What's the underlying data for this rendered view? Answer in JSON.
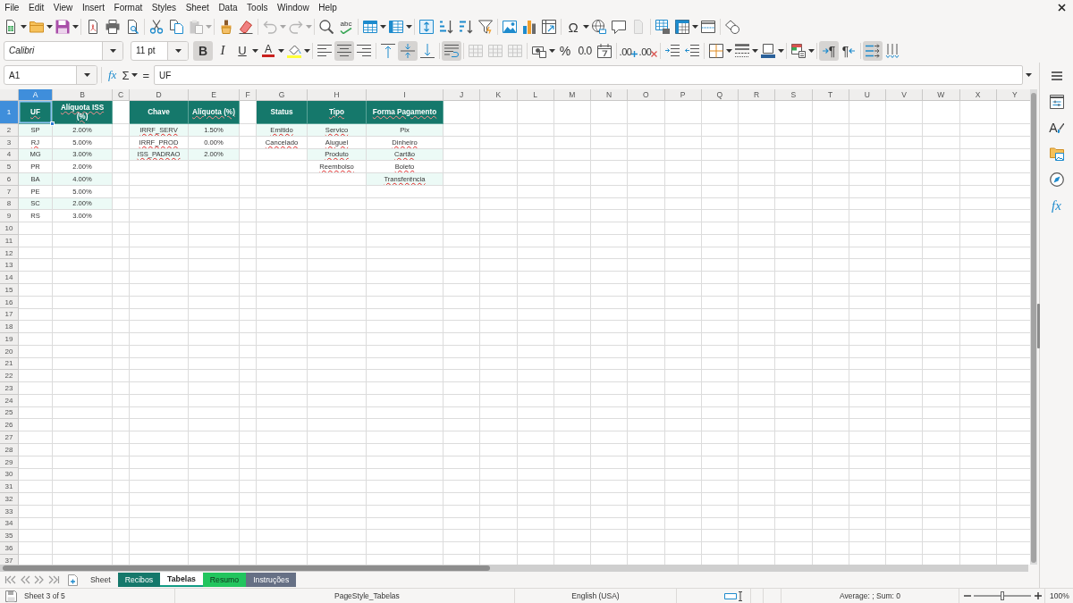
{
  "menu_bar": [
    "File",
    "Edit",
    "View",
    "Insert",
    "Format",
    "Styles",
    "Sheet",
    "Data",
    "Tools",
    "Window",
    "Help"
  ],
  "standard_toolbar": {
    "groups": [
      [
        {
          "kind": "new",
          "disabled": false,
          "dropdown": true
        },
        {
          "kind": "open",
          "disabled": false,
          "dropdown": true
        },
        {
          "kind": "save",
          "disabled": false,
          "dropdown": true
        }
      ],
      [
        {
          "kind": "export_pdf",
          "disabled": false,
          "dropdown": false
        },
        {
          "kind": "print",
          "disabled": false,
          "dropdown": false
        },
        {
          "kind": "print_preview",
          "disabled": false,
          "dropdown": false
        }
      ],
      [
        {
          "kind": "cut",
          "disabled": false,
          "dropdown": false
        },
        {
          "kind": "copy",
          "disabled": false,
          "dropdown": false
        },
        {
          "kind": "paste",
          "disabled": true,
          "dropdown": true
        }
      ],
      [
        {
          "kind": "clone_formatting",
          "disabled": false,
          "dropdown": false
        },
        {
          "kind": "clear_formatting",
          "disabled": false,
          "dropdown": false
        }
      ],
      [
        {
          "kind": "undo",
          "disabled": true,
          "dropdown": true
        },
        {
          "kind": "redo",
          "disabled": true,
          "dropdown": true
        }
      ],
      [
        {
          "kind": "find_replace",
          "disabled": false,
          "dropdown": false
        },
        {
          "kind": "spelling",
          "label": "abc",
          "disabled": false,
          "dropdown": false
        }
      ],
      [
        {
          "kind": "rows",
          "disabled": false,
          "dropdown": true
        },
        {
          "kind": "columns",
          "disabled": false,
          "dropdown": true
        }
      ],
      [
        {
          "kind": "sort",
          "disabled": false,
          "dropdown": false
        },
        {
          "kind": "sort_ascending",
          "disabled": false,
          "dropdown": false
        },
        {
          "kind": "sort_descending",
          "disabled": false,
          "dropdown": false
        },
        {
          "kind": "autofilter",
          "disabled": false,
          "dropdown": false
        }
      ],
      [
        {
          "kind": "image",
          "disabled": false,
          "dropdown": false
        },
        {
          "kind": "chart",
          "disabled": false,
          "dropdown": false
        },
        {
          "kind": "pivot_table",
          "disabled": false,
          "dropdown": false
        }
      ],
      [
        {
          "kind": "special_character",
          "label": "Ω",
          "disabled": false,
          "dropdown": true
        },
        {
          "kind": "hyperlink",
          "disabled": false,
          "dropdown": false
        },
        {
          "kind": "comment",
          "disabled": false,
          "dropdown": false
        },
        {
          "kind": "headers_footers",
          "disabled": true,
          "dropdown": false
        }
      ],
      [
        {
          "kind": "print_area",
          "disabled": false,
          "dropdown": false
        },
        {
          "kind": "freeze",
          "disabled": false,
          "dropdown": true
        },
        {
          "kind": "split_window",
          "disabled": false,
          "dropdown": false
        }
      ],
      [
        {
          "kind": "draw_functions",
          "disabled": false,
          "dropdown": false
        }
      ]
    ]
  },
  "formatting_toolbar": {
    "font_name": "Calibri",
    "font_size": "11 pt",
    "groups": [
      [
        {
          "kind": "bold",
          "label": "B",
          "pressed": true,
          "disabled": false,
          "dropdown": false
        },
        {
          "kind": "italic",
          "label": "I",
          "pressed": false,
          "disabled": false,
          "dropdown": false
        },
        {
          "kind": "underline",
          "label": "U",
          "pressed": false,
          "disabled": false,
          "dropdown": true
        },
        {
          "kind": "font_color",
          "label": "A",
          "pressed": false,
          "disabled": false,
          "dropdown": true
        },
        {
          "kind": "highlight",
          "pressed": false,
          "disabled": false,
          "dropdown": true
        }
      ],
      [
        {
          "kind": "align_left",
          "pressed": false,
          "disabled": false,
          "dropdown": false
        },
        {
          "kind": "align_center",
          "pressed": true,
          "disabled": false,
          "dropdown": false
        },
        {
          "kind": "align_right",
          "pressed": false,
          "disabled": false,
          "dropdown": false
        }
      ],
      [
        {
          "kind": "align_top",
          "pressed": false,
          "disabled": false,
          "dropdown": false
        },
        {
          "kind": "align_middle",
          "pressed": true,
          "disabled": false,
          "dropdown": false
        },
        {
          "kind": "align_bottom",
          "pressed": false,
          "disabled": false,
          "dropdown": false
        }
      ],
      [
        {
          "kind": "wrap_text",
          "pressed": true,
          "disabled": false,
          "dropdown": false
        }
      ],
      [
        {
          "kind": "merge_center",
          "pressed": false,
          "disabled": true,
          "dropdown": false
        },
        {
          "kind": "merge",
          "pressed": false,
          "disabled": true,
          "dropdown": false
        },
        {
          "kind": "unmerge",
          "pressed": false,
          "disabled": true,
          "dropdown": false
        }
      ],
      [
        {
          "kind": "currency",
          "pressed": false,
          "disabled": false,
          "dropdown": true
        },
        {
          "kind": "percent",
          "label": "%",
          "pressed": false,
          "disabled": false,
          "dropdown": false
        },
        {
          "kind": "standard",
          "label": "0.0",
          "pressed": false,
          "disabled": false,
          "dropdown": false
        },
        {
          "kind": "date",
          "pressed": false,
          "disabled": false,
          "dropdown": false
        }
      ],
      [
        {
          "kind": "add_decimal",
          "label": ".00",
          "pressed": false,
          "disabled": false,
          "dropdown": false
        },
        {
          "kind": "delete_decimal",
          "label": ".00",
          "pressed": false,
          "disabled": false,
          "dropdown": false
        }
      ],
      [
        {
          "kind": "indent_increase",
          "pressed": false,
          "disabled": false,
          "dropdown": false
        },
        {
          "kind": "indent_decrease",
          "pressed": false,
          "disabled": false,
          "dropdown": false
        }
      ],
      [
        {
          "kind": "borders",
          "pressed": false,
          "disabled": false,
          "dropdown": true
        },
        {
          "kind": "border_style",
          "pressed": false,
          "disabled": false,
          "dropdown": true
        },
        {
          "kind": "border_color",
          "pressed": false,
          "disabled": false,
          "dropdown": true
        }
      ],
      [
        {
          "kind": "conditional",
          "pressed": false,
          "disabled": false,
          "dropdown": true
        }
      ],
      [
        {
          "kind": "paragraph_ltr",
          "label": "¶",
          "pressed": true,
          "disabled": false,
          "dropdown": false
        },
        {
          "kind": "paragraph_rtl",
          "label": "¶",
          "pressed": false,
          "disabled": false,
          "dropdown": false
        }
      ],
      [
        {
          "kind": "text_ltr",
          "pressed": true,
          "disabled": false,
          "dropdown": false
        },
        {
          "kind": "text_vertical",
          "pressed": false,
          "disabled": false,
          "dropdown": false
        }
      ]
    ]
  },
  "formula_bar": {
    "name_box": "A1",
    "function_wizard": "fx",
    "sum": "Σ",
    "equals": "=",
    "formula": "UF"
  },
  "sheet": {
    "columns": [
      {
        "label": "A",
        "selected": true
      },
      {
        "label": "B",
        "selected": false
      },
      {
        "label": "C",
        "selected": false
      },
      {
        "label": "D",
        "selected": false
      },
      {
        "label": "E",
        "selected": false
      },
      {
        "label": "F",
        "selected": false
      },
      {
        "label": "G",
        "selected": false
      },
      {
        "label": "H",
        "selected": false
      },
      {
        "label": "I",
        "selected": false
      },
      {
        "label": "J",
        "selected": false
      },
      {
        "label": "K",
        "selected": false
      },
      {
        "label": "L",
        "selected": false
      },
      {
        "label": "M",
        "selected": false
      },
      {
        "label": "N",
        "selected": false
      },
      {
        "label": "O",
        "selected": false
      },
      {
        "label": "P",
        "selected": false
      },
      {
        "label": "Q",
        "selected": false
      },
      {
        "label": "R",
        "selected": false
      },
      {
        "label": "S",
        "selected": false
      },
      {
        "label": "T",
        "selected": false
      },
      {
        "label": "U",
        "selected": false
      },
      {
        "label": "V",
        "selected": false
      },
      {
        "label": "W",
        "selected": false
      },
      {
        "label": "X",
        "selected": false
      },
      {
        "label": "Y",
        "selected": false
      }
    ],
    "rows": [
      {
        "label": "1",
        "selected": true
      },
      {
        "label": "2",
        "selected": false
      },
      {
        "label": "3",
        "selected": false
      },
      {
        "label": "4",
        "selected": false
      },
      {
        "label": "5",
        "selected": false
      },
      {
        "label": "6",
        "selected": false
      },
      {
        "label": "7",
        "selected": false
      },
      {
        "label": "8",
        "selected": false
      },
      {
        "label": "9",
        "selected": false
      },
      {
        "label": "10",
        "selected": false
      },
      {
        "label": "11",
        "selected": false
      },
      {
        "label": "12",
        "selected": false
      },
      {
        "label": "13",
        "selected": false
      },
      {
        "label": "14",
        "selected": false
      },
      {
        "label": "15",
        "selected": false
      },
      {
        "label": "16",
        "selected": false
      },
      {
        "label": "17",
        "selected": false
      },
      {
        "label": "18",
        "selected": false
      },
      {
        "label": "19",
        "selected": false
      },
      {
        "label": "20",
        "selected": false
      },
      {
        "label": "21",
        "selected": false
      },
      {
        "label": "22",
        "selected": false
      },
      {
        "label": "23",
        "selected": false
      },
      {
        "label": "24",
        "selected": false
      },
      {
        "label": "25",
        "selected": false
      },
      {
        "label": "26",
        "selected": false
      },
      {
        "label": "27",
        "selected": false
      },
      {
        "label": "28",
        "selected": false
      },
      {
        "label": "29",
        "selected": false
      },
      {
        "label": "30",
        "selected": false
      },
      {
        "label": "31",
        "selected": false
      },
      {
        "label": "32",
        "selected": false
      },
      {
        "label": "33",
        "selected": false
      },
      {
        "label": "34",
        "selected": false
      },
      {
        "label": "35",
        "selected": false
      },
      {
        "label": "36",
        "selected": false
      },
      {
        "label": "37",
        "selected": false
      }
    ],
    "tables": [
      {
        "columns": [
          {
            "heading": {
              "text": "UF",
              "misspelled": true
            },
            "values": [
              {
                "text": "SP",
                "misspelled": false
              },
              {
                "text": "RJ",
                "misspelled": true
              },
              {
                "text": "MG",
                "misspelled": false
              },
              {
                "text": "PR",
                "misspelled": false
              },
              {
                "text": "BA",
                "misspelled": false
              },
              {
                "text": "PE",
                "misspelled": false
              },
              {
                "text": "SC",
                "misspelled": false
              },
              {
                "text": "RS",
                "misspelled": false
              }
            ]
          },
          {
            "heading": {
              "text": "Alíquota ISS (%)",
              "misspelled": true
            },
            "values": [
              {
                "text": "2.00%",
                "misspelled": false
              },
              {
                "text": "5.00%",
                "misspelled": false
              },
              {
                "text": "3.00%",
                "misspelled": false
              },
              {
                "text": "2.00%",
                "misspelled": false
              },
              {
                "text": "4.00%",
                "misspelled": false
              },
              {
                "text": "5.00%",
                "misspelled": false
              },
              {
                "text": "2.00%",
                "misspelled": false
              },
              {
                "text": "3.00%",
                "misspelled": false
              }
            ]
          }
        ]
      },
      {
        "columns": [
          {
            "heading": {
              "text": "Chave",
              "misspelled": false
            },
            "values": [
              {
                "text": "IRRF_SERV",
                "misspelled": true
              },
              {
                "text": "IRRF_PROD",
                "misspelled": true
              },
              {
                "text": "ISS_PADRAO",
                "misspelled": true
              }
            ]
          },
          {
            "heading": {
              "text": "Alíquota (%)",
              "misspelled": true
            },
            "values": [
              {
                "text": "1.50%",
                "misspelled": false
              },
              {
                "text": "0.00%",
                "misspelled": false
              },
              {
                "text": "2.00%",
                "misspelled": false
              }
            ]
          }
        ]
      },
      {
        "columns": [
          {
            "heading": {
              "text": "Status",
              "misspelled": false
            },
            "values": [
              {
                "text": "Emitido",
                "misspelled": true
              },
              {
                "text": "Cancelado",
                "misspelled": true
              }
            ]
          },
          {
            "heading": {
              "text": "Tipo",
              "misspelled": true
            },
            "values": [
              {
                "text": "Servico",
                "misspelled": true
              },
              {
                "text": "Aluguel",
                "misspelled": true
              },
              {
                "text": "Produto",
                "misspelled": true
              },
              {
                "text": "Reembolso",
                "misspelled": true
              }
            ]
          },
          {
            "heading": {
              "text": "Forma Pagamento",
              "misspelled": true
            },
            "values": [
              {
                "text": "Pix",
                "misspelled": false
              },
              {
                "text": "Dinheiro",
                "misspelled": true
              },
              {
                "text": "Cartão",
                "misspelled": true
              },
              {
                "text": "Boleto",
                "misspelled": true
              },
              {
                "text": "Transferência",
                "misspelled": true
              }
            ]
          }
        ]
      }
    ]
  },
  "sheet_tabs": [
    {
      "label": "Sheet",
      "selected": false
    },
    {
      "label": "Recibos",
      "selected": false,
      "color": "#15786b"
    },
    {
      "label": "Tabelas",
      "selected": true,
      "color": "#139a84"
    },
    {
      "label": "Resumo",
      "selected": false,
      "color": "#22c55e"
    },
    {
      "label": "Instruções",
      "selected": false,
      "color": "#667085"
    }
  ],
  "sidebar": {
    "buttons": [
      {
        "kind": "properties"
      },
      {
        "kind": "styles",
        "label": "A"
      },
      {
        "kind": "gallery"
      },
      {
        "kind": "navigator"
      },
      {
        "kind": "functions",
        "label": "fx"
      }
    ]
  },
  "status_bar": {
    "sheet_position": "Sheet 3 of 5",
    "page_style": "PageStyle_Tabelas",
    "language": "English (USA)",
    "selection_summary": "Average: ; Sum: 0",
    "zoom_slider": {
      "level": 0.5
    },
    "zoom": "100%"
  }
}
